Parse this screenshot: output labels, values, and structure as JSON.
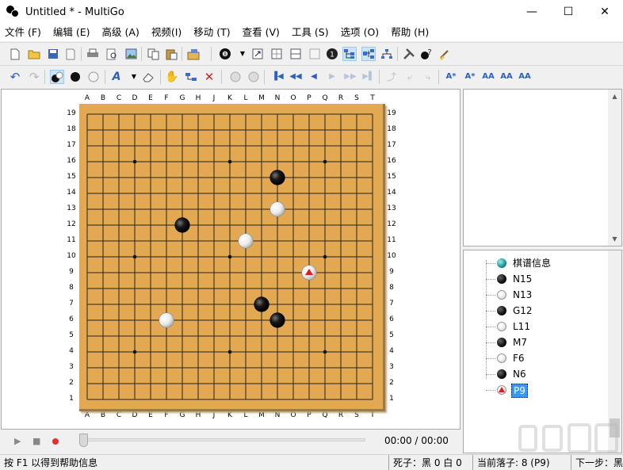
{
  "window": {
    "title": "Untitled  * - MultiGo",
    "minimize": "—",
    "maximize": "☐",
    "close": "✕"
  },
  "menu": [
    "文件 (F)",
    "编辑 (E)",
    "高级 (A)",
    "视频(I)",
    "移动 (T)",
    "查看 (V)",
    "工具 (S)",
    "选项 (O)",
    "帮助 (H)"
  ],
  "board": {
    "size": 19,
    "columns": [
      "A",
      "B",
      "C",
      "D",
      "E",
      "F",
      "G",
      "H",
      "J",
      "K",
      "L",
      "M",
      "N",
      "O",
      "P",
      "Q",
      "R",
      "S",
      "T"
    ],
    "rows": [
      "19",
      "18",
      "17",
      "16",
      "15",
      "14",
      "13",
      "12",
      "11",
      "10",
      "9",
      "8",
      "7",
      "6",
      "5",
      "4",
      "3",
      "2",
      "1"
    ],
    "stones": [
      {
        "move": "N15",
        "color": "black"
      },
      {
        "move": "N13",
        "color": "white"
      },
      {
        "move": "G12",
        "color": "black"
      },
      {
        "move": "L11",
        "color": "white"
      },
      {
        "move": "M7",
        "color": "black"
      },
      {
        "move": "F6",
        "color": "white"
      },
      {
        "move": "N6",
        "color": "black"
      },
      {
        "move": "P9",
        "color": "white",
        "last": true
      }
    ]
  },
  "playback": {
    "time": "00:00 / 00:00",
    "progress": 0
  },
  "tree": [
    {
      "label": "棋谱信息",
      "icon": "teal"
    },
    {
      "label": "N15",
      "icon": "black"
    },
    {
      "label": "N13",
      "icon": "white"
    },
    {
      "label": "G12",
      "icon": "black"
    },
    {
      "label": "L11",
      "icon": "white"
    },
    {
      "label": "M7",
      "icon": "black"
    },
    {
      "label": "F6",
      "icon": "white"
    },
    {
      "label": "N6",
      "icon": "black"
    },
    {
      "label": "P9",
      "icon": "current",
      "selected": true
    }
  ],
  "status": {
    "help": "按 F1 以得到帮助信息",
    "captures": "死子：黑 0 白 0",
    "current": "当前落子: 8 (P9)",
    "next": "下一步：黑"
  },
  "colors": {
    "board": "#e3a952",
    "selection": "#3399ff",
    "last_move_marker": "#d92020"
  }
}
